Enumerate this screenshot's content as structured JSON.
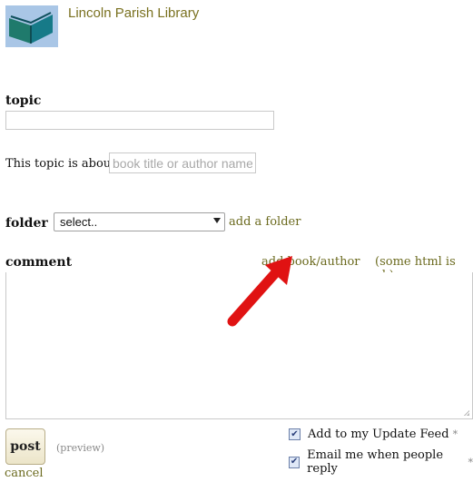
{
  "header": {
    "library_name": "Lincoln Parish Library"
  },
  "form": {
    "topic_label": "topic",
    "topic_value": "",
    "about_label": "This topic is about",
    "about_placeholder": "book title or author name",
    "folder_label": "folder",
    "folder_selected": "select..",
    "add_folder_label": "add a folder",
    "comment_label": "comment",
    "add_book_author_label": "add book/author",
    "html_note": "(some html is ok)",
    "post_label": "post",
    "preview_label": "(preview)",
    "cancel_label": "cancel",
    "options": [
      {
        "label": "Add to my Update Feed",
        "checked": true,
        "note": "*"
      },
      {
        "label": "Email me when people reply",
        "checked": true,
        "note": "*"
      }
    ]
  },
  "annotation": {
    "arrow_color": "#e01212"
  },
  "colors": {
    "link": "#6b6a1e",
    "logo_bg": "#a9c6e6",
    "logo_book": "#1f7a6c"
  }
}
